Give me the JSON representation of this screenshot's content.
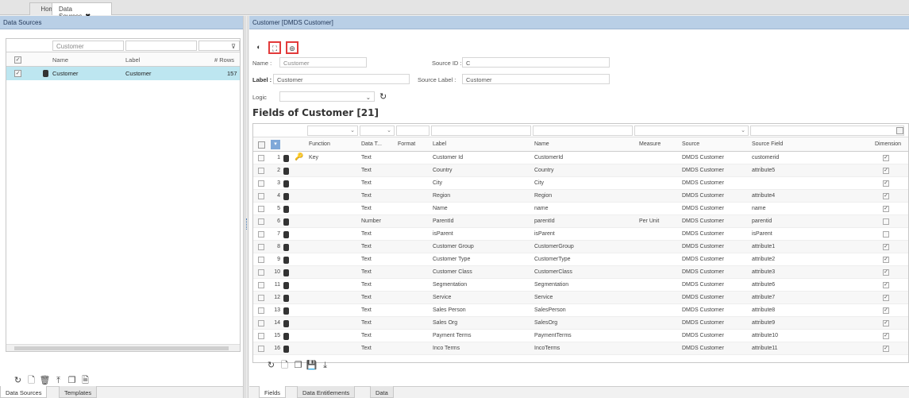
{
  "top_tabs": [
    {
      "label": "Home"
    },
    {
      "label": "Data Sources",
      "close": "✖"
    }
  ],
  "left": {
    "header": "Data Sources",
    "filter_name": "Customer",
    "columns": {
      "name": "Name",
      "label": "Label",
      "rows": "# Rows"
    },
    "row": {
      "name": "Customer",
      "label": "Customer",
      "rows": "157"
    },
    "bottom_tabs": [
      "Data Sources",
      "Templates"
    ]
  },
  "right": {
    "header": "Customer  [DMDS Customer]",
    "form": {
      "name_label": "Name :",
      "name_value": "Customer",
      "source_id_label": "Source ID :",
      "source_id_value": "C",
      "label_label": "Label :",
      "label_value": "Customer",
      "source_label_label": "Source Label :",
      "source_label_value": "Customer",
      "logic_label": "Logic"
    },
    "title": "Fields of Customer [21]",
    "columns": [
      "Function",
      "Data T...",
      "Format",
      "Label",
      "Name",
      "Measure",
      "Source",
      "Source Field",
      "Dimension"
    ],
    "rows": [
      {
        "n": "1",
        "fn": "Key",
        "type": "Text",
        "label": "Customer Id",
        "name": "CustomerId",
        "measure": "",
        "source": "DMDS Customer",
        "sfield": "customerid",
        "dim": true
      },
      {
        "n": "2",
        "fn": "",
        "type": "Text",
        "label": "Country",
        "name": "Country",
        "measure": "",
        "source": "DMDS Customer",
        "sfield": "attribute5",
        "dim": true
      },
      {
        "n": "3",
        "fn": "",
        "type": "Text",
        "label": "City",
        "name": "City",
        "measure": "",
        "source": "DMDS Customer",
        "sfield": "",
        "dim": true
      },
      {
        "n": "4",
        "fn": "",
        "type": "Text",
        "label": "Region",
        "name": "Region",
        "measure": "",
        "source": "DMDS Customer",
        "sfield": "attribute4",
        "dim": true
      },
      {
        "n": "5",
        "fn": "",
        "type": "Text",
        "label": "Name",
        "name": "name",
        "measure": "",
        "source": "DMDS Customer",
        "sfield": "name",
        "dim": true
      },
      {
        "n": "6",
        "fn": "",
        "type": "Number",
        "label": "ParentId",
        "name": "parentId",
        "measure": "Per Unit",
        "source": "DMDS Customer",
        "sfield": "parentid",
        "dim": false
      },
      {
        "n": "7",
        "fn": "",
        "type": "Text",
        "label": "isParent",
        "name": "isParent",
        "measure": "",
        "source": "DMDS Customer",
        "sfield": "isParent",
        "dim": false
      },
      {
        "n": "8",
        "fn": "",
        "type": "Text",
        "label": "Customer Group",
        "name": "CustomerGroup",
        "measure": "",
        "source": "DMDS Customer",
        "sfield": "attribute1",
        "dim": true
      },
      {
        "n": "9",
        "fn": "",
        "type": "Text",
        "label": "Customer Type",
        "name": "CustomerType",
        "measure": "",
        "source": "DMDS Customer",
        "sfield": "attribute2",
        "dim": true
      },
      {
        "n": "10",
        "fn": "",
        "type": "Text",
        "label": "Customer Class",
        "name": "CustomerClass",
        "measure": "",
        "source": "DMDS Customer",
        "sfield": "attribute3",
        "dim": true
      },
      {
        "n": "11",
        "fn": "",
        "type": "Text",
        "label": "Segmentation",
        "name": "Segmentation",
        "measure": "",
        "source": "DMDS Customer",
        "sfield": "attribute6",
        "dim": true
      },
      {
        "n": "12",
        "fn": "",
        "type": "Text",
        "label": "Service",
        "name": "Service",
        "measure": "",
        "source": "DMDS Customer",
        "sfield": "attribute7",
        "dim": true
      },
      {
        "n": "13",
        "fn": "",
        "type": "Text",
        "label": "Sales Person",
        "name": "SalesPerson",
        "measure": "",
        "source": "DMDS Customer",
        "sfield": "attribute8",
        "dim": true
      },
      {
        "n": "14",
        "fn": "",
        "type": "Text",
        "label": "Sales Org",
        "name": "SalesOrg",
        "measure": "",
        "source": "DMDS Customer",
        "sfield": "attribute9",
        "dim": true
      },
      {
        "n": "15",
        "fn": "",
        "type": "Text",
        "label": "Payment Terms",
        "name": "PaymentTerms",
        "measure": "",
        "source": "DMDS Customer",
        "sfield": "attribute10",
        "dim": true
      },
      {
        "n": "16",
        "fn": "",
        "type": "Text",
        "label": "Inco Terms",
        "name": "IncoTerms",
        "measure": "",
        "source": "DMDS Customer",
        "sfield": "attribute11",
        "dim": true
      }
    ],
    "bottom_tabs": [
      "Fields",
      "Data Entitlements",
      "Data"
    ]
  },
  "icons": {
    "left_toolbar": [
      "refresh-icon",
      "new-file-icon",
      "delete-icon",
      "upload-icon",
      "copy-icon",
      "export-icon"
    ],
    "right_toolbar_top": [
      "settings-icon",
      "expand-icon",
      "preview-icon"
    ],
    "right_toolbar_bottom": [
      "refresh-icon",
      "new-file-icon",
      "copy-icon",
      "save-icon",
      "download-icon"
    ]
  },
  "colors": {
    "panel_header": "#b9cfe6",
    "selected_row": "#bde6f0",
    "highlight": "#e23b3b"
  }
}
